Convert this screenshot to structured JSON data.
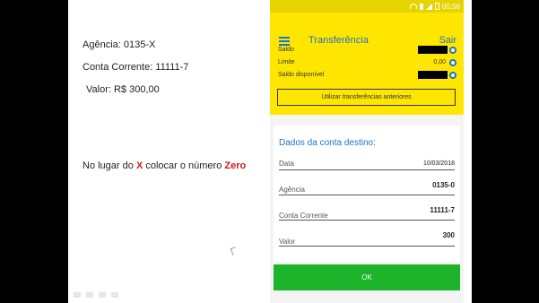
{
  "slide": {
    "agencia": "Agência:  0135-X",
    "conta": "Conta Corrente: 11111-7",
    "valor": "Valor:  R$ 300,00",
    "instruction_prefix": "No lugar do ",
    "instruction_x": "X",
    "instruction_mid": " colocar o número ",
    "instruction_zero": "Zero"
  },
  "statusbar": {
    "time": "00:56"
  },
  "app": {
    "title": "Transferência",
    "logout_label": "Sair",
    "balances": {
      "saldo_label": "Saldo",
      "limite_label": "Limite",
      "limite_value": "0,00",
      "disponivel_label": "Saldo disponível"
    },
    "previous_transfers_label": "Utilizar transferências anteriores"
  },
  "form": {
    "section_title": "Dados da conta destino:",
    "data_label": "Data",
    "data_value": "10/03/2018",
    "agencia_label": "Agência",
    "agencia_value": "0135-0",
    "conta_label": "Conta Corrente",
    "conta_value": "11111-7",
    "valor_label": "Valor",
    "valor_value": "300",
    "ok_label": "OK"
  },
  "colors": {
    "brand_yellow": "#ffe600",
    "brand_blue": "#1f73c9",
    "ok_green": "#1db32a",
    "highlight_red": "#d0191a"
  }
}
